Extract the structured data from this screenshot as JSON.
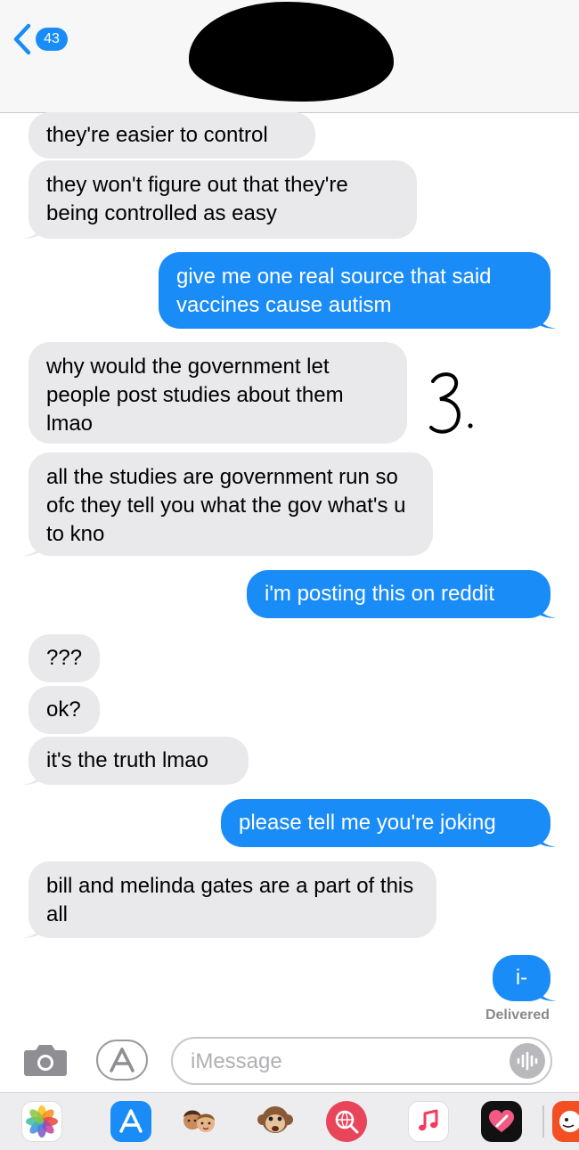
{
  "header": {
    "back_count": "43"
  },
  "messages": [
    {
      "dir": "received",
      "text": "they're easier to control"
    },
    {
      "dir": "received",
      "text": "they won't figure out that they're being controlled as easy"
    },
    {
      "dir": "sent",
      "text": "give me one real source that said vaccines cause autism"
    },
    {
      "dir": "received",
      "text": "why would the government let people post studies about them lmao"
    },
    {
      "dir": "received",
      "text": "all the studies are government run so ofc they tell you what the gov what's u to kno"
    },
    {
      "dir": "sent",
      "text": "i'm posting this on reddit"
    },
    {
      "dir": "received",
      "text": "???"
    },
    {
      "dir": "received",
      "text": "ok?"
    },
    {
      "dir": "received",
      "text": "it's the truth lmao"
    },
    {
      "dir": "sent",
      "text": "please tell me you're joking"
    },
    {
      "dir": "received",
      "text": "bill and melinda gates are a part of this all"
    },
    {
      "dir": "sent",
      "text": "i-"
    }
  ],
  "annotation": "3.",
  "status": {
    "delivered": "Delivered"
  },
  "composer": {
    "placeholder": "iMessage"
  },
  "app_drawer": {
    "apps": [
      "photos-icon",
      "app-store-icon",
      "memoji-icon",
      "monkey-animoji-icon",
      "web-search-icon",
      "music-icon",
      "digital-touch-icon",
      "sticker-icon"
    ]
  },
  "colors": {
    "sent_bubble": "#1a8cf7",
    "received_bubble": "#e9e9eb",
    "header_bg": "#f7f7f8",
    "accent": "#1a8cf7"
  }
}
